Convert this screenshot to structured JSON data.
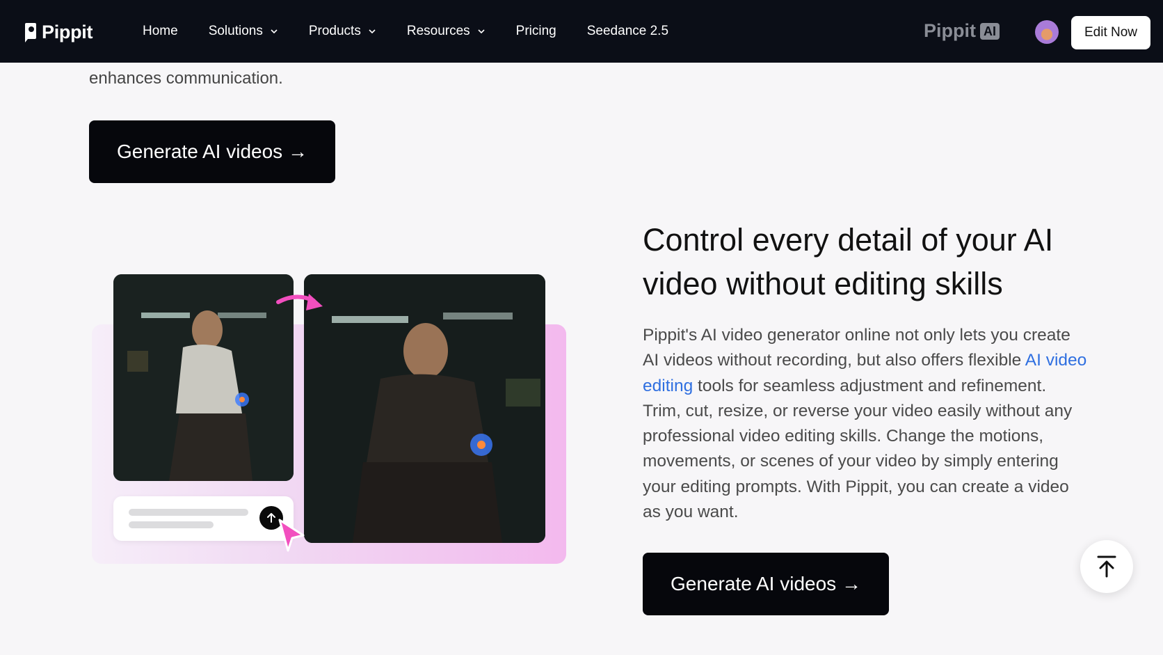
{
  "nav": {
    "logo_text": "Pippit",
    "links": [
      {
        "label": "Home",
        "has_dropdown": false
      },
      {
        "label": "Solutions",
        "has_dropdown": true
      },
      {
        "label": "Products",
        "has_dropdown": true
      },
      {
        "label": "Resources",
        "has_dropdown": true
      },
      {
        "label": "Pricing",
        "has_dropdown": false
      },
      {
        "label": "Seedance 2.5",
        "has_dropdown": false
      }
    ],
    "brand_right": "Pippit",
    "brand_badge": "AI",
    "edit_now_label": "Edit Now"
  },
  "intro": {
    "tail_text": "enhances communication.",
    "cta_label": "Generate AI videos →"
  },
  "feature": {
    "heading": "Control every detail of your AI video without editing skills",
    "para_part1": "Pippit's AI video generator online not only lets you create AI videos without recording, but also offers flexible ",
    "para_link": "AI video editing",
    "para_part2": " tools for seamless adjustment and refinement. Trim, cut, resize, or reverse your video easily without any professional video editing skills. Change the motions, movements, or scenes of your video by simply entering your editing prompts. With Pippit, you can create a video as you want.",
    "cta_label": "Generate AI videos →"
  },
  "colors": {
    "nav_bg": "#0b0e17",
    "cta_bg": "#06070c",
    "link": "#2f6fe0",
    "accent_pink": "#f24fbf"
  },
  "icons": {
    "scroll_top": "arrow-up-to-top-icon",
    "send": "arrow-up-icon",
    "cursor": "pointer-cursor-icon"
  }
}
